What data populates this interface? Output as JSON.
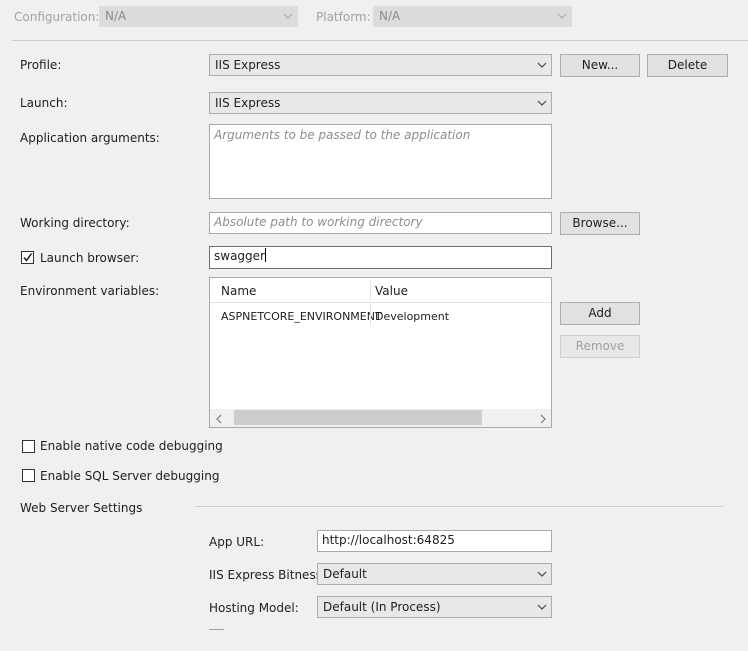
{
  "config_bar": {
    "configuration_label": "Configuration:",
    "configuration_value": "N/A",
    "platform_label": "Platform:",
    "platform_value": "N/A"
  },
  "profile": {
    "label": "Profile:",
    "value": "IIS Express",
    "new_button": "New...",
    "delete_button": "Delete"
  },
  "launch": {
    "label": "Launch:",
    "value": "IIS Express"
  },
  "app_args": {
    "label": "Application arguments:",
    "placeholder": "Arguments to be passed to the application"
  },
  "working_dir": {
    "label": "Working directory:",
    "placeholder": "Absolute path to working directory",
    "browse_button": "Browse..."
  },
  "launch_browser": {
    "label": "Launch browser:",
    "checked": true,
    "value": "swagger"
  },
  "env_vars": {
    "label": "Environment variables:",
    "columns": [
      "Name",
      "Value"
    ],
    "rows": [
      {
        "name": "ASPNETCORE_ENVIRONMENT",
        "value": "Development"
      }
    ],
    "add_button": "Add",
    "remove_button": "Remove"
  },
  "native_debugging": {
    "label": "Enable native code debugging",
    "checked": false
  },
  "sql_debugging": {
    "label": "Enable SQL Server debugging",
    "checked": false
  },
  "web_server": {
    "section_title": "Web Server Settings",
    "app_url_label": "App URL:",
    "app_url_value": "http://localhost:64825",
    "bitness_label": "IIS Express Bitness:",
    "bitness_value": "Default",
    "hosting_label": "Hosting Model:",
    "hosting_value": "Default (In Process)"
  }
}
